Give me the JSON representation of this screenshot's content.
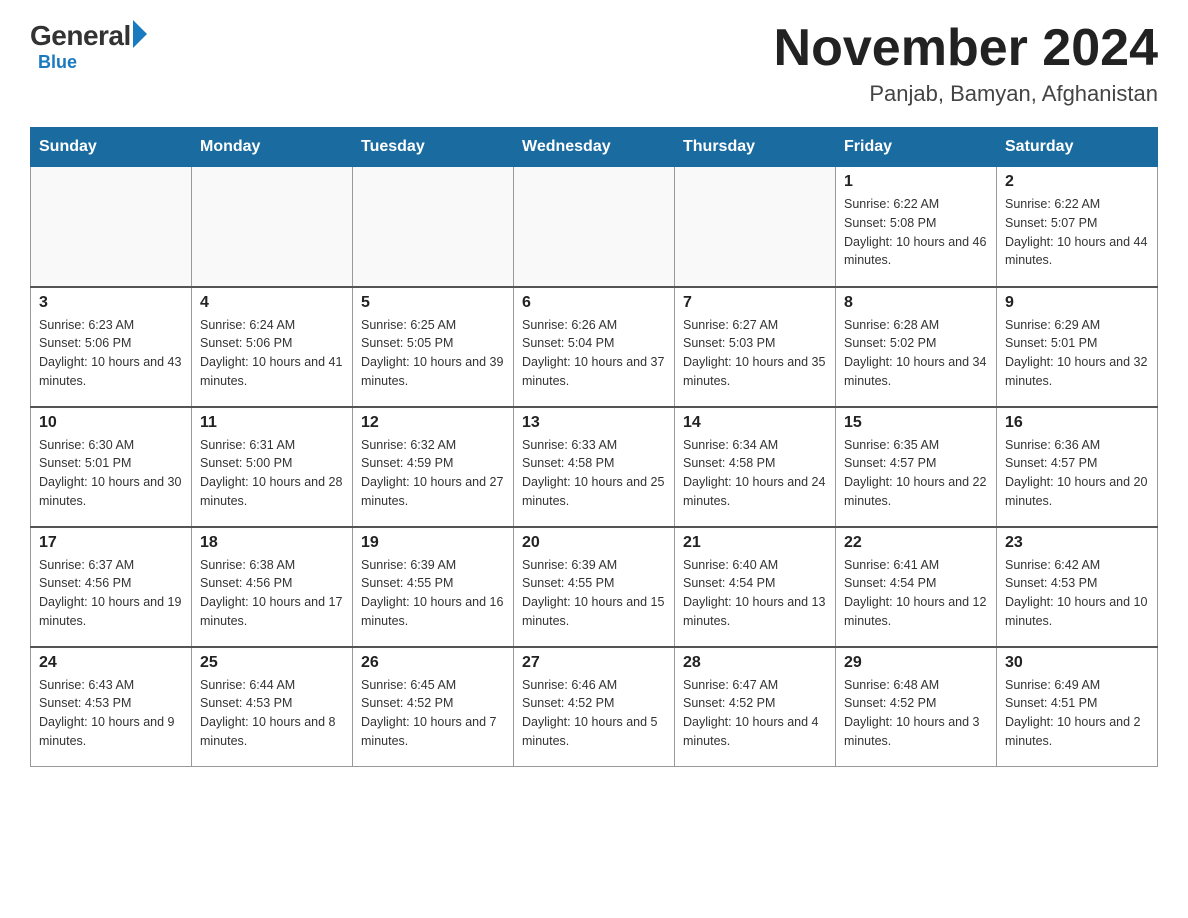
{
  "header": {
    "logo_general": "General",
    "logo_blue": "Blue",
    "month_title": "November 2024",
    "location": "Panjab, Bamyan, Afghanistan"
  },
  "days_of_week": [
    "Sunday",
    "Monday",
    "Tuesday",
    "Wednesday",
    "Thursday",
    "Friday",
    "Saturday"
  ],
  "weeks": [
    [
      {
        "day": "",
        "info": ""
      },
      {
        "day": "",
        "info": ""
      },
      {
        "day": "",
        "info": ""
      },
      {
        "day": "",
        "info": ""
      },
      {
        "day": "",
        "info": ""
      },
      {
        "day": "1",
        "info": "Sunrise: 6:22 AM\nSunset: 5:08 PM\nDaylight: 10 hours and 46 minutes."
      },
      {
        "day": "2",
        "info": "Sunrise: 6:22 AM\nSunset: 5:07 PM\nDaylight: 10 hours and 44 minutes."
      }
    ],
    [
      {
        "day": "3",
        "info": "Sunrise: 6:23 AM\nSunset: 5:06 PM\nDaylight: 10 hours and 43 minutes."
      },
      {
        "day": "4",
        "info": "Sunrise: 6:24 AM\nSunset: 5:06 PM\nDaylight: 10 hours and 41 minutes."
      },
      {
        "day": "5",
        "info": "Sunrise: 6:25 AM\nSunset: 5:05 PM\nDaylight: 10 hours and 39 minutes."
      },
      {
        "day": "6",
        "info": "Sunrise: 6:26 AM\nSunset: 5:04 PM\nDaylight: 10 hours and 37 minutes."
      },
      {
        "day": "7",
        "info": "Sunrise: 6:27 AM\nSunset: 5:03 PM\nDaylight: 10 hours and 35 minutes."
      },
      {
        "day": "8",
        "info": "Sunrise: 6:28 AM\nSunset: 5:02 PM\nDaylight: 10 hours and 34 minutes."
      },
      {
        "day": "9",
        "info": "Sunrise: 6:29 AM\nSunset: 5:01 PM\nDaylight: 10 hours and 32 minutes."
      }
    ],
    [
      {
        "day": "10",
        "info": "Sunrise: 6:30 AM\nSunset: 5:01 PM\nDaylight: 10 hours and 30 minutes."
      },
      {
        "day": "11",
        "info": "Sunrise: 6:31 AM\nSunset: 5:00 PM\nDaylight: 10 hours and 28 minutes."
      },
      {
        "day": "12",
        "info": "Sunrise: 6:32 AM\nSunset: 4:59 PM\nDaylight: 10 hours and 27 minutes."
      },
      {
        "day": "13",
        "info": "Sunrise: 6:33 AM\nSunset: 4:58 PM\nDaylight: 10 hours and 25 minutes."
      },
      {
        "day": "14",
        "info": "Sunrise: 6:34 AM\nSunset: 4:58 PM\nDaylight: 10 hours and 24 minutes."
      },
      {
        "day": "15",
        "info": "Sunrise: 6:35 AM\nSunset: 4:57 PM\nDaylight: 10 hours and 22 minutes."
      },
      {
        "day": "16",
        "info": "Sunrise: 6:36 AM\nSunset: 4:57 PM\nDaylight: 10 hours and 20 minutes."
      }
    ],
    [
      {
        "day": "17",
        "info": "Sunrise: 6:37 AM\nSunset: 4:56 PM\nDaylight: 10 hours and 19 minutes."
      },
      {
        "day": "18",
        "info": "Sunrise: 6:38 AM\nSunset: 4:56 PM\nDaylight: 10 hours and 17 minutes."
      },
      {
        "day": "19",
        "info": "Sunrise: 6:39 AM\nSunset: 4:55 PM\nDaylight: 10 hours and 16 minutes."
      },
      {
        "day": "20",
        "info": "Sunrise: 6:39 AM\nSunset: 4:55 PM\nDaylight: 10 hours and 15 minutes."
      },
      {
        "day": "21",
        "info": "Sunrise: 6:40 AM\nSunset: 4:54 PM\nDaylight: 10 hours and 13 minutes."
      },
      {
        "day": "22",
        "info": "Sunrise: 6:41 AM\nSunset: 4:54 PM\nDaylight: 10 hours and 12 minutes."
      },
      {
        "day": "23",
        "info": "Sunrise: 6:42 AM\nSunset: 4:53 PM\nDaylight: 10 hours and 10 minutes."
      }
    ],
    [
      {
        "day": "24",
        "info": "Sunrise: 6:43 AM\nSunset: 4:53 PM\nDaylight: 10 hours and 9 minutes."
      },
      {
        "day": "25",
        "info": "Sunrise: 6:44 AM\nSunset: 4:53 PM\nDaylight: 10 hours and 8 minutes."
      },
      {
        "day": "26",
        "info": "Sunrise: 6:45 AM\nSunset: 4:52 PM\nDaylight: 10 hours and 7 minutes."
      },
      {
        "day": "27",
        "info": "Sunrise: 6:46 AM\nSunset: 4:52 PM\nDaylight: 10 hours and 5 minutes."
      },
      {
        "day": "28",
        "info": "Sunrise: 6:47 AM\nSunset: 4:52 PM\nDaylight: 10 hours and 4 minutes."
      },
      {
        "day": "29",
        "info": "Sunrise: 6:48 AM\nSunset: 4:52 PM\nDaylight: 10 hours and 3 minutes."
      },
      {
        "day": "30",
        "info": "Sunrise: 6:49 AM\nSunset: 4:51 PM\nDaylight: 10 hours and 2 minutes."
      }
    ]
  ]
}
